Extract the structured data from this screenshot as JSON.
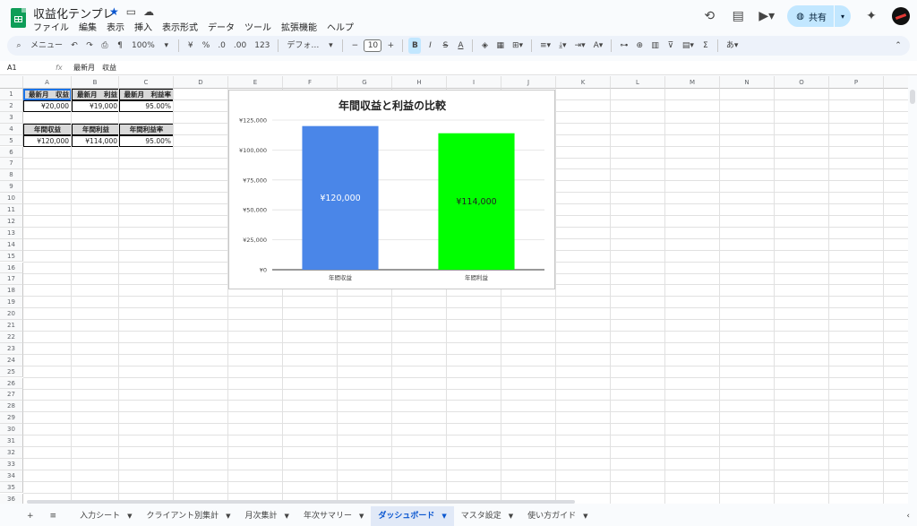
{
  "app": {
    "title": "収益化テンプレ",
    "menu": [
      "ファイル",
      "編集",
      "表示",
      "挿入",
      "表示形式",
      "データ",
      "ツール",
      "拡張機能",
      "ヘルプ"
    ],
    "share_label": "共有",
    "accent": "#0b57d0",
    "logo_color": "#0f9d58"
  },
  "toolbar": {
    "menu_search": "メニュー",
    "zoom": "100%",
    "currency": "¥",
    "percent": "%",
    "dec_dec": ".0",
    "dec_inc": ".00",
    "num_format": "123",
    "font": "デフォ…",
    "font_size": "10",
    "bold": "B",
    "italic": "I",
    "strike": "S",
    "text_color": "A"
  },
  "formula_bar": {
    "name_box": "A1",
    "fx": "fx",
    "content": "最新月　収益"
  },
  "columns": [
    "A",
    "B",
    "C",
    "D",
    "E",
    "F",
    "G",
    "H",
    "I",
    "J",
    "K",
    "L",
    "M",
    "N",
    "O",
    "P",
    "Q"
  ],
  "row_count": 36,
  "cells": {
    "a1": "最新月　収益",
    "b1": "最新月　利益",
    "c1": "最新月　利益率",
    "a2": "¥20,000",
    "b2": "¥19,000",
    "c2": "95.00%",
    "a4": "年間収益",
    "b4": "年間利益",
    "c4": "年間利益率",
    "a5": "¥120,000",
    "b5": "¥114,000",
    "c5": "95.00%"
  },
  "chart_data": {
    "type": "bar",
    "title": "年間収益と利益の比較",
    "categories": [
      "年間収益",
      "年間利益"
    ],
    "values": [
      120000,
      114000
    ],
    "data_labels": [
      "¥120,000",
      "¥114,000"
    ],
    "colors": [
      "#4a86e8",
      "#00ff00"
    ],
    "yticks": [
      "¥0",
      "¥25,000",
      "¥50,000",
      "¥75,000",
      "¥100,000",
      "¥125,000"
    ],
    "ylim": [
      0,
      125000
    ],
    "grid": true,
    "legend": "none"
  },
  "tabs": [
    {
      "label": "入力シート",
      "active": false
    },
    {
      "label": "クライアント別集計",
      "active": false
    },
    {
      "label": "月次集計",
      "active": false
    },
    {
      "label": "年次サマリー",
      "active": false
    },
    {
      "label": "ダッシュボード",
      "active": true
    },
    {
      "label": "マスタ設定",
      "active": false
    },
    {
      "label": "使い方ガイド",
      "active": false
    }
  ]
}
